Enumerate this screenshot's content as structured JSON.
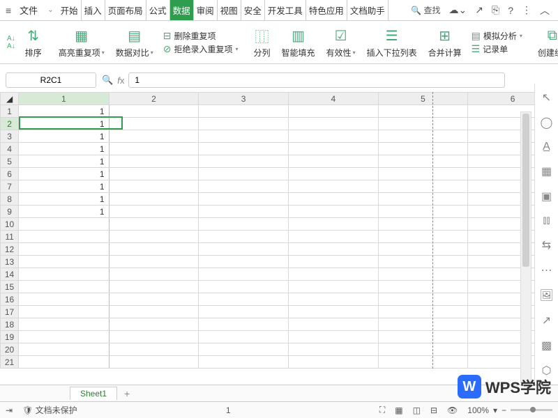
{
  "menu": {
    "file": "文件",
    "tabs": [
      "开始",
      "插入",
      "页面布局",
      "公式",
      "数据",
      "审阅",
      "视图",
      "安全",
      "开发工具",
      "特色应用",
      "文档助手"
    ],
    "activeTab": 4,
    "search": "查找"
  },
  "ribbon": {
    "sort": "排序",
    "highlight": "高亮重复项",
    "compare": "数据对比",
    "dup_remove": "删除重复项",
    "dup_reject": "拒绝录入重复项",
    "split": "分列",
    "smartfill": "智能填充",
    "validity": "有效性",
    "dropdown": "插入下拉列表",
    "consolidate": "合并计算",
    "sim": "模拟分析",
    "record": "记录单",
    "group": "创建组"
  },
  "namebox": "R2C1",
  "formula": "1",
  "cols": [
    "1",
    "2",
    "3",
    "4",
    "5",
    "6"
  ],
  "rows": 21,
  "data_col1": [
    "1",
    "1",
    "1",
    "1",
    "1",
    "1",
    "1",
    "1",
    "1"
  ],
  "selection": {
    "row": 2,
    "col": 1
  },
  "sheet": "Sheet1",
  "status": {
    "protect": "文档未保护",
    "count": "1",
    "zoom": "100%"
  },
  "watermark": "WPS学院"
}
